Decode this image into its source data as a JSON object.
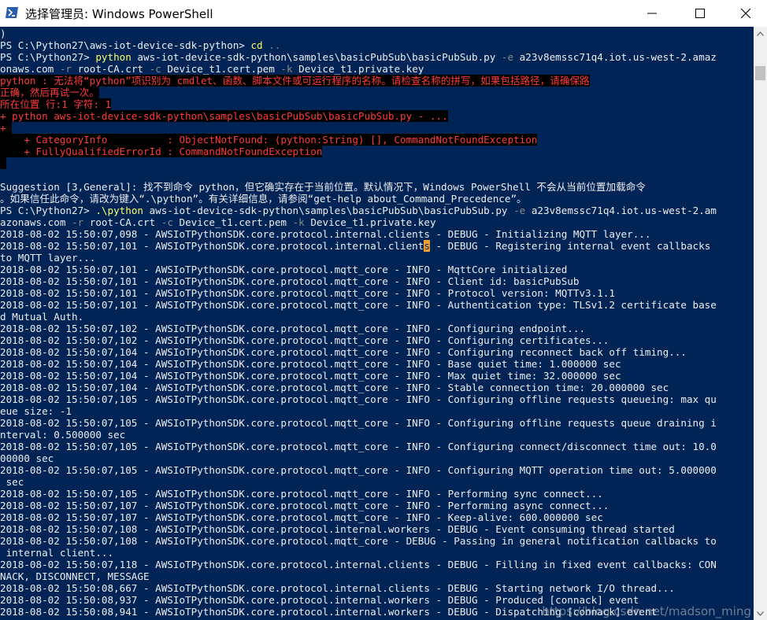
{
  "window": {
    "title": "选择管理员: Windows PowerShell",
    "app_icon": "powershell-icon",
    "controls": {
      "minimize": "minimize-icon",
      "maximize": "maximize-icon",
      "close": "close-icon"
    }
  },
  "colors": {
    "console_bg": "#012456",
    "console_text": "#eeedf0",
    "error_text": "#ff3a3a",
    "error_bg": "#000000",
    "command": "#ffff66",
    "parameter": "#8a8a8a"
  },
  "console": {
    "lines": [
      {
        "segments": [
          {
            "text": ")",
            "kind": "plain"
          }
        ]
      },
      {
        "segments": [
          {
            "text": "PS C:\\Python27\\aws-iot-device-sdk-python> ",
            "kind": "plain"
          },
          {
            "text": "cd",
            "kind": "cmd"
          },
          {
            "text": " ..",
            "kind": "par"
          }
        ]
      },
      {
        "segments": [
          {
            "text": "PS C:\\Python27> ",
            "kind": "plain"
          },
          {
            "text": "python",
            "kind": "cmd"
          },
          {
            "text": " aws-iot-device-sdk-python\\samples\\basicPubSub\\basicPubSub.py ",
            "kind": "plain"
          },
          {
            "text": "-e",
            "kind": "par"
          },
          {
            "text": " a23v8emssc71q4.iot.us-west-2.amaz",
            "kind": "plain"
          }
        ]
      },
      {
        "segments": [
          {
            "text": "onaws.com ",
            "kind": "plain"
          },
          {
            "text": "-r",
            "kind": "par"
          },
          {
            "text": " root-CA.crt ",
            "kind": "plain"
          },
          {
            "text": "-c",
            "kind": "par"
          },
          {
            "text": " Device_t1.cert.pem ",
            "kind": "plain"
          },
          {
            "text": "-k",
            "kind": "par"
          },
          {
            "text": " Device_t1.private.key",
            "kind": "plain"
          }
        ]
      },
      {
        "segments": [
          {
            "text": "python : 无法将“python”项识别为 cmdlet、函数、脚本文件或可运行程序的名称。请检查名称的拼写，如果包括路径，请确保路",
            "kind": "err"
          }
        ]
      },
      {
        "segments": [
          {
            "text": "正确，然后再试一次。",
            "kind": "err"
          }
        ]
      },
      {
        "segments": [
          {
            "text": "所在位置 行:1 字符: 1",
            "kind": "err"
          }
        ]
      },
      {
        "segments": [
          {
            "text": "+ python aws-iot-device-sdk-python\\samples\\basicPubSub\\basicPubSub.py - ...",
            "kind": "err"
          }
        ]
      },
      {
        "segments": [
          {
            "text": "+ ",
            "kind": "err"
          }
        ]
      },
      {
        "segments": [
          {
            "text": "    + CategoryInfo          : ObjectNotFound: (python:String) [], CommandNotFoundException",
            "kind": "err"
          }
        ]
      },
      {
        "segments": [
          {
            "text": "    + FullyQualifiedErrorId : CommandNotFoundException",
            "kind": "err"
          }
        ]
      },
      {
        "segments": [
          {
            "text": " ",
            "kind": "err"
          }
        ]
      },
      {
        "segments": [
          {
            "text": "",
            "kind": "plain"
          }
        ]
      },
      {
        "segments": [
          {
            "text": "Suggestion [3,General]: 找不到命令 python，但它确实存在于当前位置。默认情况下，Windows PowerShell 不会从当前位置加载命令",
            "kind": "plain"
          }
        ]
      },
      {
        "segments": [
          {
            "text": "。如果信任此命令，请改为键入“.\\python”。有关详细信息，请参阅“get-help about_Command_Precedence”。",
            "kind": "plain"
          }
        ]
      },
      {
        "segments": [
          {
            "text": "PS C:\\Python27> ",
            "kind": "plain"
          },
          {
            "text": ".\\python",
            "kind": "cmd"
          },
          {
            "text": " aws-iot-device-sdk-python\\samples\\basicPubSub\\basicPubSub.py ",
            "kind": "plain"
          },
          {
            "text": "-e",
            "kind": "par"
          },
          {
            "text": " a23v8emssc71q4.iot.us-west-2.am",
            "kind": "plain"
          }
        ]
      },
      {
        "segments": [
          {
            "text": "azonaws.com ",
            "kind": "plain"
          },
          {
            "text": "-r",
            "kind": "par"
          },
          {
            "text": " root-CA.crt ",
            "kind": "plain"
          },
          {
            "text": "-c",
            "kind": "par"
          },
          {
            "text": " Device_t1.cert.pem ",
            "kind": "plain"
          },
          {
            "text": "-k",
            "kind": "par"
          },
          {
            "text": " Device_t1.private.key",
            "kind": "plain"
          }
        ]
      },
      {
        "segments": [
          {
            "text": "2018-08-02 15:50:07,098 - AWSIoTPythonSDK.core.protocol.internal.clients - DEBUG - Initializing MQTT layer...",
            "kind": "plain"
          }
        ]
      },
      {
        "segments": [
          {
            "text": "2018-08-02 15:50:07,101 - AWSIoTPythonSDK.core.protocol.internal.client",
            "kind": "plain"
          },
          {
            "text": "s",
            "kind": "cursor"
          },
          {
            "text": " - DEBUG - Registering internal event callbacks",
            "kind": "plain"
          }
        ]
      },
      {
        "segments": [
          {
            "text": "to MQTT layer...",
            "kind": "plain"
          }
        ]
      },
      {
        "segments": [
          {
            "text": "2018-08-02 15:50:07,101 - AWSIoTPythonSDK.core.protocol.mqtt_core - INFO - MqttCore initialized",
            "kind": "plain"
          }
        ]
      },
      {
        "segments": [
          {
            "text": "2018-08-02 15:50:07,101 - AWSIoTPythonSDK.core.protocol.mqtt_core - INFO - Client id: basicPubSub",
            "kind": "plain"
          }
        ]
      },
      {
        "segments": [
          {
            "text": "2018-08-02 15:50:07,101 - AWSIoTPythonSDK.core.protocol.mqtt_core - INFO - Protocol version: MQTTv3.1.1",
            "kind": "plain"
          }
        ]
      },
      {
        "segments": [
          {
            "text": "2018-08-02 15:50:07,101 - AWSIoTPythonSDK.core.protocol.mqtt_core - INFO - Authentication type: TLSv1.2 certificate base",
            "kind": "plain"
          }
        ]
      },
      {
        "segments": [
          {
            "text": "d Mutual Auth.",
            "kind": "plain"
          }
        ]
      },
      {
        "segments": [
          {
            "text": "2018-08-02 15:50:07,102 - AWSIoTPythonSDK.core.protocol.mqtt_core - INFO - Configuring endpoint...",
            "kind": "plain"
          }
        ]
      },
      {
        "segments": [
          {
            "text": "2018-08-02 15:50:07,102 - AWSIoTPythonSDK.core.protocol.mqtt_core - INFO - Configuring certificates...",
            "kind": "plain"
          }
        ]
      },
      {
        "segments": [
          {
            "text": "2018-08-02 15:50:07,104 - AWSIoTPythonSDK.core.protocol.mqtt_core - INFO - Configuring reconnect back off timing...",
            "kind": "plain"
          }
        ]
      },
      {
        "segments": [
          {
            "text": "2018-08-02 15:50:07,104 - AWSIoTPythonSDK.core.protocol.mqtt_core - INFO - Base quiet time: 1.000000 sec",
            "kind": "plain"
          }
        ]
      },
      {
        "segments": [
          {
            "text": "2018-08-02 15:50:07,104 - AWSIoTPythonSDK.core.protocol.mqtt_core - INFO - Max quiet time: 32.000000 sec",
            "kind": "plain"
          }
        ]
      },
      {
        "segments": [
          {
            "text": "2018-08-02 15:50:07,104 - AWSIoTPythonSDK.core.protocol.mqtt_core - INFO - Stable connection time: 20.000000 sec",
            "kind": "plain"
          }
        ]
      },
      {
        "segments": [
          {
            "text": "2018-08-02 15:50:07,105 - AWSIoTPythonSDK.core.protocol.mqtt_core - INFO - Configuring offline requests queueing: max qu",
            "kind": "plain"
          }
        ]
      },
      {
        "segments": [
          {
            "text": "eue size: -1",
            "kind": "plain"
          }
        ]
      },
      {
        "segments": [
          {
            "text": "2018-08-02 15:50:07,105 - AWSIoTPythonSDK.core.protocol.mqtt_core - INFO - Configuring offline requests queue draining i",
            "kind": "plain"
          }
        ]
      },
      {
        "segments": [
          {
            "text": "nterval: 0.500000 sec",
            "kind": "plain"
          }
        ]
      },
      {
        "segments": [
          {
            "text": "2018-08-02 15:50:07,105 - AWSIoTPythonSDK.core.protocol.mqtt_core - INFO - Configuring connect/disconnect time out: 10.0",
            "kind": "plain"
          }
        ]
      },
      {
        "segments": [
          {
            "text": "00000 sec",
            "kind": "plain"
          }
        ]
      },
      {
        "segments": [
          {
            "text": "2018-08-02 15:50:07,105 - AWSIoTPythonSDK.core.protocol.mqtt_core - INFO - Configuring MQTT operation time out: 5.000000",
            "kind": "plain"
          }
        ]
      },
      {
        "segments": [
          {
            "text": " sec",
            "kind": "plain"
          }
        ]
      },
      {
        "segments": [
          {
            "text": "2018-08-02 15:50:07,105 - AWSIoTPythonSDK.core.protocol.mqtt_core - INFO - Performing sync connect...",
            "kind": "plain"
          }
        ]
      },
      {
        "segments": [
          {
            "text": "2018-08-02 15:50:07,107 - AWSIoTPythonSDK.core.protocol.mqtt_core - INFO - Performing async connect...",
            "kind": "plain"
          }
        ]
      },
      {
        "segments": [
          {
            "text": "2018-08-02 15:50:07,107 - AWSIoTPythonSDK.core.protocol.mqtt_core - INFO - Keep-alive: 600.000000 sec",
            "kind": "plain"
          }
        ]
      },
      {
        "segments": [
          {
            "text": "2018-08-02 15:50:07,108 - AWSIoTPythonSDK.core.protocol.internal.workers - DEBUG - Event consuming thread started",
            "kind": "plain"
          }
        ]
      },
      {
        "segments": [
          {
            "text": "2018-08-02 15:50:07,108 - AWSIoTPythonSDK.core.protocol.mqtt_core - DEBUG - Passing in general notification callbacks to",
            "kind": "plain"
          }
        ]
      },
      {
        "segments": [
          {
            "text": " internal client...",
            "kind": "plain"
          }
        ]
      },
      {
        "segments": [
          {
            "text": "2018-08-02 15:50:07,118 - AWSIoTPythonSDK.core.protocol.internal.clients - DEBUG - Filling in fixed event callbacks: CON",
            "kind": "plain"
          }
        ]
      },
      {
        "segments": [
          {
            "text": "NACK, DISCONNECT, MESSAGE",
            "kind": "plain"
          }
        ]
      },
      {
        "segments": [
          {
            "text": "2018-08-02 15:50:08,667 - AWSIoTPythonSDK.core.protocol.internal.clients - DEBUG - Starting network I/O thread...",
            "kind": "plain"
          }
        ]
      },
      {
        "segments": [
          {
            "text": "2018-08-02 15:50:08,937 - AWSIoTPythonSDK.core.protocol.internal.workers - DEBUG - Produced [connack] event",
            "kind": "plain"
          }
        ]
      },
      {
        "segments": [
          {
            "text": "2018-08-02 15:50:08,941 - AWSIoTPythonSDK.core.protocol.internal.workers - DEBUG - Dispatching [connack] event",
            "kind": "plain"
          }
        ]
      }
    ]
  },
  "scrollbar": {
    "up": "scroll-up-arrow-icon",
    "down": "scroll-down-arrow-icon"
  },
  "watermark": "https://blog.csdn.net/madson_ming"
}
